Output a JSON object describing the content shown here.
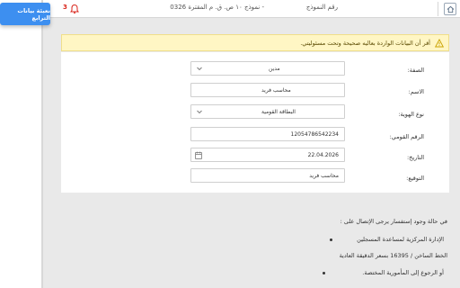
{
  "topbar": {
    "form_label": "رقم النموذج",
    "form_value": "- نموذج ١٠ ص. ق. م المقترة 0326",
    "notification_count": "3"
  },
  "overlay_button": {
    "label": "نعبئة بيانات الترابع"
  },
  "warning": {
    "text": "أقر أن البيانات الواردة بعاليه صحيحة وتحت مسئوليتي."
  },
  "form": {
    "fields": [
      {
        "label": "الصفة:",
        "value": "مدين"
      },
      {
        "label": "الاسم:",
        "value": "محاسب فريد"
      },
      {
        "label": "نوع الهوية:",
        "value": "البطاقة القومية"
      },
      {
        "label": "الرقم القومي:",
        "value": "12054786542234"
      },
      {
        "label": "التاريخ:",
        "value": "22.04.2026"
      },
      {
        "label": "التوقيع:",
        "value": "محاسب فريد"
      }
    ]
  },
  "contact": {
    "intro": "في حالة وجود إستفسار يرجى الإتصال على :",
    "item1": "الإدارة المركزية لمساعدة المسجلين",
    "hotline": "الخط الساخن / 16395 بسعر الدقيقة العادية",
    "item2": "أو الرجوع إلى المأمورية المختصة."
  },
  "colors": {
    "accent_blue": "#3d8ff0",
    "warning_bg": "#fff6c4",
    "bell_red": "#d9261c"
  },
  "icons": [
    "home-icon",
    "bell-icon",
    "warning-icon",
    "chevron-down-icon",
    "calendar-icon"
  ]
}
